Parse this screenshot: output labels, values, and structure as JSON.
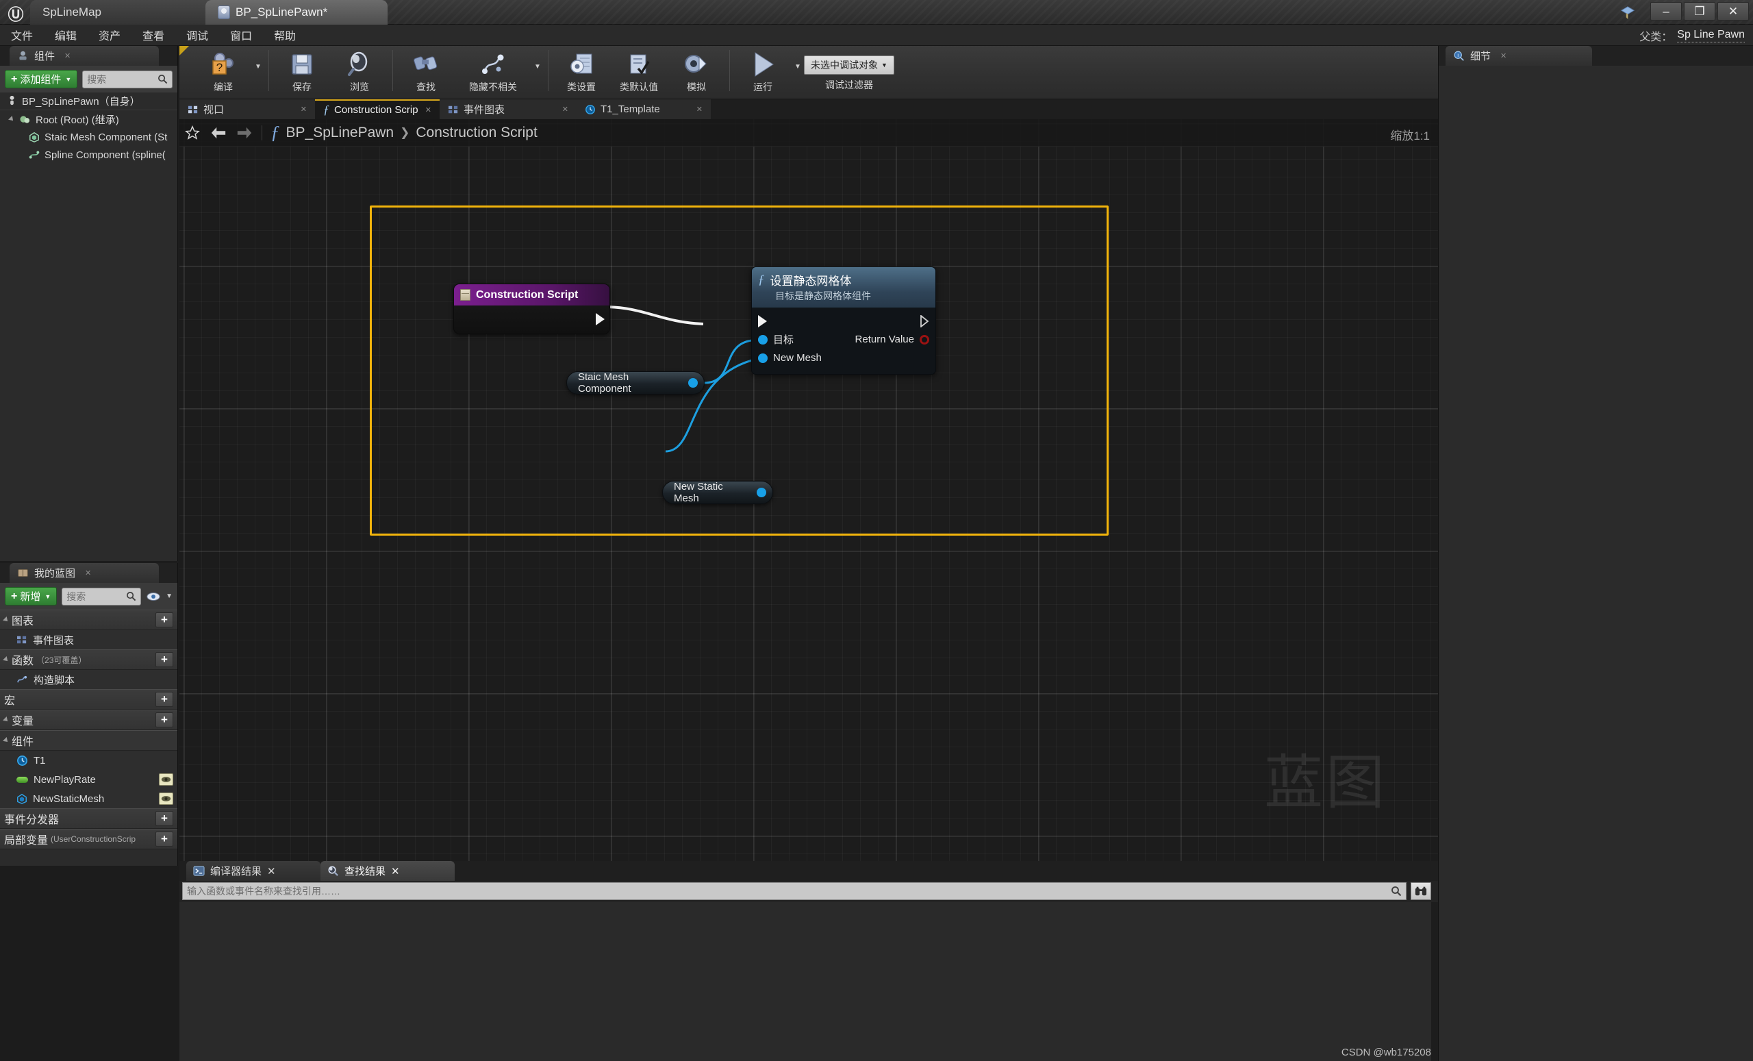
{
  "window": {
    "tabs": [
      {
        "label": "SpLineMap",
        "active": false
      },
      {
        "label": "BP_SpLinePawn*",
        "active": true
      }
    ],
    "buttons": {
      "minimize": "–",
      "maximize": "❐",
      "close": "✕"
    }
  },
  "menubar": {
    "items": [
      "文件",
      "编辑",
      "资产",
      "查看",
      "调试",
      "窗口",
      "帮助"
    ]
  },
  "parent_class": {
    "label": "父类：",
    "value": "Sp Line Pawn"
  },
  "toolbar": {
    "groups": [
      {
        "items": [
          {
            "label": "编译",
            "icon": "compile-icon",
            "caret": true
          }
        ]
      },
      {
        "items": [
          {
            "label": "保存",
            "icon": "save-icon",
            "caret": false
          },
          {
            "label": "浏览",
            "icon": "browse-icon",
            "caret": false
          }
        ]
      },
      {
        "items": [
          {
            "label": "查找",
            "icon": "find-icon",
            "caret": false
          },
          {
            "label": "隐藏不相关",
            "icon": "hide-unrelated-icon",
            "caret": true
          }
        ]
      },
      {
        "items": [
          {
            "label": "类设置",
            "icon": "class-settings-icon",
            "caret": false
          },
          {
            "label": "类默认值",
            "icon": "class-defaults-icon",
            "caret": false
          },
          {
            "label": "模拟",
            "icon": "simulate-icon",
            "caret": false
          }
        ]
      },
      {
        "items": [
          {
            "label": "运行",
            "icon": "play-icon",
            "caret": true
          }
        ]
      }
    ],
    "debug_object": "未选中调试对象",
    "debug_filter_label": "调试过滤器"
  },
  "components_panel": {
    "tab_label": "组件",
    "tab_icon": "components-icon",
    "add_button": "添加组件",
    "search_placeholder": "搜索",
    "tree": [
      {
        "label": "BP_SpLinePawn（自身）",
        "icon": "pawn-icon",
        "indent": 0
      },
      {
        "label": "Root (Root) (继承)",
        "icon": "sphere-icon",
        "indent": 1,
        "expander": true
      },
      {
        "label": "Staic Mesh Component (St",
        "icon": "staticmesh-icon",
        "indent": 2
      },
      {
        "label": "Spline Component (spline(",
        "icon": "spline-icon",
        "indent": 2
      }
    ]
  },
  "myblueprint_panel": {
    "tab_label": "我的蓝图",
    "tab_icon": "book-icon",
    "add_button": "新增",
    "search_placeholder": "搜索",
    "eye_icon": "eye-icon",
    "sections": [
      {
        "type": "section",
        "label": "图表",
        "sub": "",
        "plus": true,
        "expander": true
      },
      {
        "type": "row",
        "label": "事件图表",
        "icon": "graph-icon",
        "eye": false
      },
      {
        "type": "section",
        "label": "函数",
        "sub": "（23可覆盖）",
        "plus": true,
        "expander": true
      },
      {
        "type": "row",
        "label": "构造脚本",
        "icon": "function-icon",
        "eye": false
      },
      {
        "type": "section",
        "label": "宏",
        "sub": "",
        "plus": true,
        "expander": false
      },
      {
        "type": "section",
        "label": "变量",
        "sub": "",
        "plus": true,
        "expander": true
      },
      {
        "type": "section-sub",
        "label": "组件",
        "sub": "",
        "plus": false,
        "expander": true
      },
      {
        "type": "row",
        "label": "T1",
        "icon": "timeline-icon",
        "eye": false
      },
      {
        "type": "row",
        "label": "NewPlayRate",
        "icon": "var-float-icon",
        "eye": true
      },
      {
        "type": "row",
        "label": "NewStaticMesh",
        "icon": "var-object-icon",
        "eye": true
      },
      {
        "type": "section",
        "label": "事件分发器",
        "sub": "",
        "plus": true,
        "expander": false
      },
      {
        "type": "section",
        "label": "局部变量",
        "sub": "(UserConstructionScrip",
        "plus": true,
        "expander": false
      }
    ]
  },
  "graph_tabs": [
    {
      "label": "视口",
      "icon": "viewport-icon",
      "active": false
    },
    {
      "label": "Construction Scrip",
      "icon": "function-icon",
      "active": true
    },
    {
      "label": "事件图表",
      "icon": "graph-icon",
      "active": false
    },
    {
      "label": "T1_Template",
      "icon": "timeline-icon",
      "active": false
    }
  ],
  "graph_header": {
    "star_icon": "star-icon",
    "back_icon": "back-arrow-icon",
    "forward_icon": "forward-arrow-icon",
    "fx_icon": "function-icon",
    "breadcrumb_root": "BP_SpLinePawn",
    "breadcrumb_chevron": "❯",
    "breadcrumb_leaf": "Construction Script",
    "zoom": "缩放1:1",
    "watermark": "蓝图"
  },
  "nodes": {
    "construction_script": {
      "title": "Construction Script",
      "icon": "event-node-icon"
    },
    "set_static_mesh": {
      "title": "设置静态网格体",
      "subtitle": "目标是静态网格体组件",
      "icon": "function-icon",
      "inputs": [
        "目标",
        "New Mesh"
      ],
      "outputs": [
        "Return Value"
      ]
    },
    "get_static_mesh_component": {
      "title": "Staic Mesh Component"
    },
    "get_new_static_mesh": {
      "title": "New Static Mesh"
    }
  },
  "details_panel": {
    "tab_label": "细节",
    "tab_icon": "details-icon"
  },
  "results_panel": {
    "tabs": [
      {
        "label": "编译器结果",
        "icon": "compiler-results-icon",
        "active": false
      },
      {
        "label": "查找结果",
        "icon": "find-results-icon",
        "active": true
      }
    ],
    "search_placeholder": "输入函数或事件名称来查找引用……",
    "search_icon": "search-icon",
    "binoculars_icon": "binoculars-icon"
  },
  "credit": "CSDN @wb175208",
  "colors": {
    "accent_yellow": "#f2b40b",
    "exec_white": "#f2f2f2",
    "object_blue": "#18a0e8",
    "bool_red": "#9b1212",
    "event_purple": "#7b1f8e",
    "function_blue": "#4e6f88",
    "green_button": "#4aa74a"
  }
}
